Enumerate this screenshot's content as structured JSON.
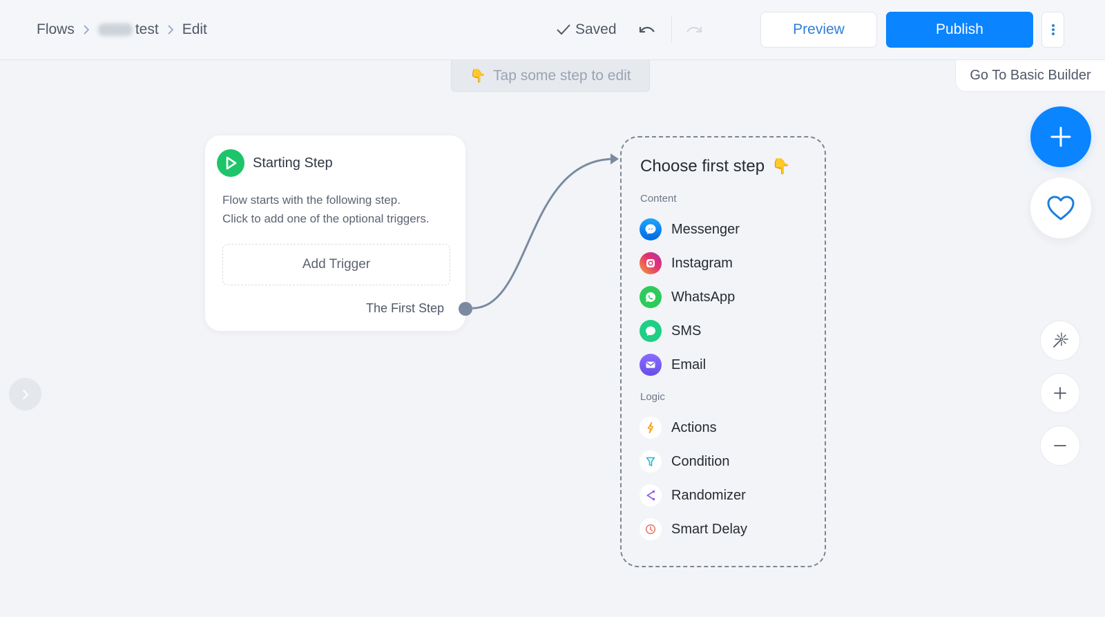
{
  "header": {
    "breadcrumb": [
      {
        "label": "Flows"
      },
      {
        "label": "test",
        "blurred_prefix": true
      },
      {
        "label": "Edit"
      }
    ],
    "status": "Saved",
    "undo_icon": "undo-icon",
    "redo_icon": "redo-icon",
    "preview_label": "Preview",
    "publish_label": "Publish",
    "more_icon": "more-vertical-icon"
  },
  "canvas": {
    "hint": "Tap some step to edit",
    "hint_emoji": "👇",
    "basic_builder_label": "Go To Basic Builder"
  },
  "starting_step": {
    "title": "Starting Step",
    "description_line1": "Flow starts with the following step.",
    "description_line2": "Click to add one of the optional triggers.",
    "add_trigger_label": "Add Trigger",
    "output_label": "The First Step"
  },
  "choose_panel": {
    "title": "Choose first step",
    "title_emoji": "👇",
    "sections": [
      {
        "label": "Content",
        "items": [
          {
            "label": "Messenger",
            "icon": "messenger-icon"
          },
          {
            "label": "Instagram",
            "icon": "instagram-icon"
          },
          {
            "label": "WhatsApp",
            "icon": "whatsapp-icon"
          },
          {
            "label": "SMS",
            "icon": "sms-icon"
          },
          {
            "label": "Email",
            "icon": "email-icon"
          }
        ]
      },
      {
        "label": "Logic",
        "items": [
          {
            "label": "Actions",
            "icon": "lightning-icon"
          },
          {
            "label": "Condition",
            "icon": "filter-icon"
          },
          {
            "label": "Randomizer",
            "icon": "split-icon"
          },
          {
            "label": "Smart Delay",
            "icon": "clock-icon"
          }
        ]
      }
    ]
  },
  "colors": {
    "accent": "#0a84ff",
    "start_green": "#1ec46a",
    "connector": "#7b8aa1",
    "canvas_bg": "#f2f4f7"
  }
}
